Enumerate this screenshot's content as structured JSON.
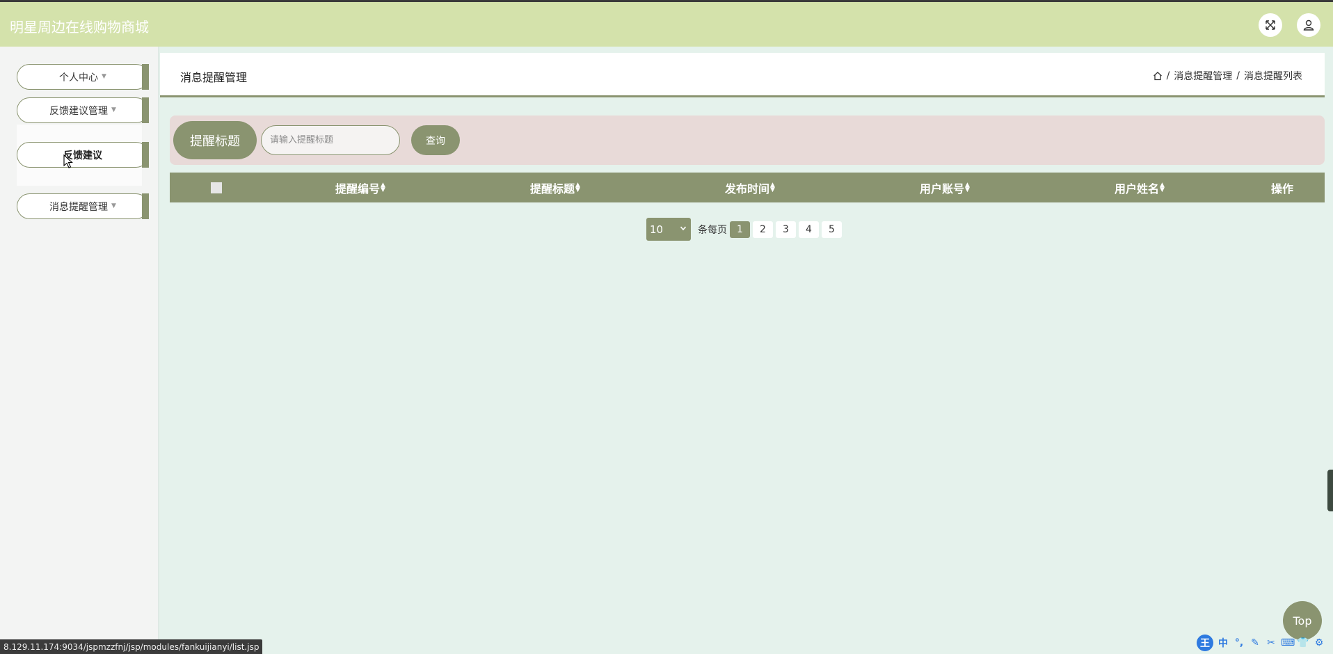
{
  "header": {
    "app_title": "明星周边在线购物商城",
    "fullscreen_icon": "expand-icon",
    "user_icon": "user-icon"
  },
  "sidebar": {
    "items": [
      {
        "label": "个人中心"
      },
      {
        "label": "反馈建议管理"
      },
      {
        "label": "消息提醒管理"
      }
    ],
    "submenu": {
      "label": "反馈建议"
    }
  },
  "breadcrumb": {
    "title": "消息提醒管理",
    "path": [
      "消息提醒管理",
      "消息提醒列表"
    ],
    "separator": "/",
    "home_icon": "home-icon"
  },
  "search": {
    "label": "提醒标题",
    "placeholder": "请输入提醒标题",
    "button": "查询"
  },
  "table": {
    "columns": [
      "提醒编号",
      "提醒标题",
      "发布时间",
      "用户账号",
      "用户姓名",
      "操作"
    ]
  },
  "pager": {
    "page_size": "10",
    "per_page_label": "条每页",
    "pages": [
      "1",
      "2",
      "3",
      "4",
      "5"
    ],
    "current": "1"
  },
  "top_button": "Top",
  "status_url": "8.129.11.174:9034/jspmzzfnj/jsp/modules/fankuijianyi/list.jsp",
  "ime": {
    "logo": "王",
    "items": [
      "中",
      "°,",
      "✎",
      "✂",
      "⌨",
      "👕",
      "⚙"
    ]
  },
  "colors": {
    "accent": "#8a9470",
    "header_bg": "#d4e2ab",
    "page_bg": "#e5f2ec",
    "search_bg": "#e8dad8"
  }
}
